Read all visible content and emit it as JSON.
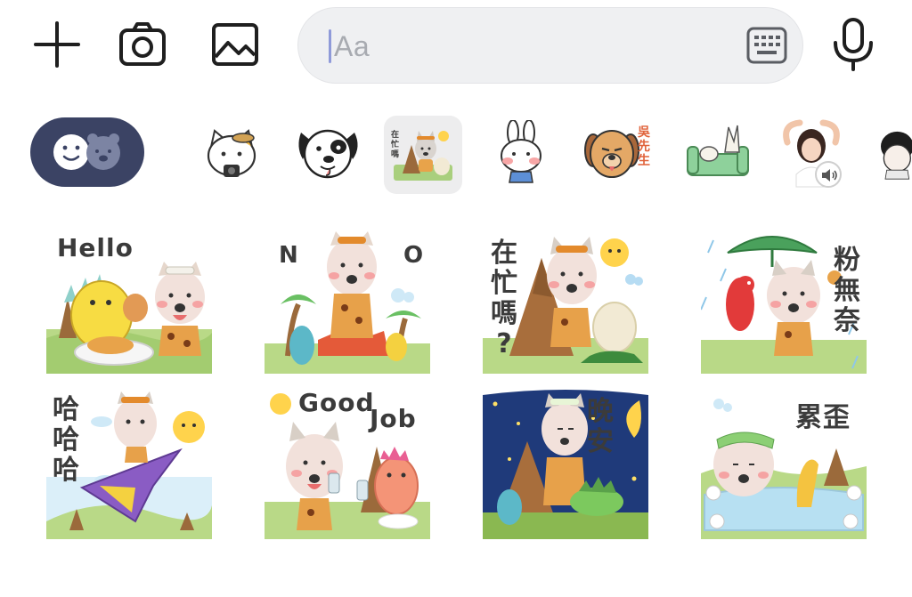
{
  "composer": {
    "placeholder": "Aa",
    "icons": [
      "plus-icon",
      "camera-icon",
      "image-icon",
      "keyboard-icon",
      "microphone-icon"
    ]
  },
  "tray": {
    "toggle_icons": [
      "smiley-icon",
      "bear-icon"
    ],
    "sticker_packs": [
      "cat-with-camera",
      "cartoon-dog",
      "husky-dino",
      "white-rabbit",
      "dog-wu-xiansheng",
      "rabbit-on-sofa",
      "girl-with-voice",
      "black-hair-character"
    ],
    "pack_label": "吳先生",
    "husky_thumb_text": "在忙嗎"
  },
  "stickers": [
    {
      "text": "Hello"
    },
    {
      "left": "N",
      "right": "O"
    },
    {
      "text": "在忙嗎?"
    },
    {
      "text": "粉無奈"
    },
    {
      "text": "哈哈哈"
    },
    {
      "line1": "Good",
      "line2": "Job"
    },
    {
      "text": "晚安"
    },
    {
      "text": "累歪"
    }
  ]
}
